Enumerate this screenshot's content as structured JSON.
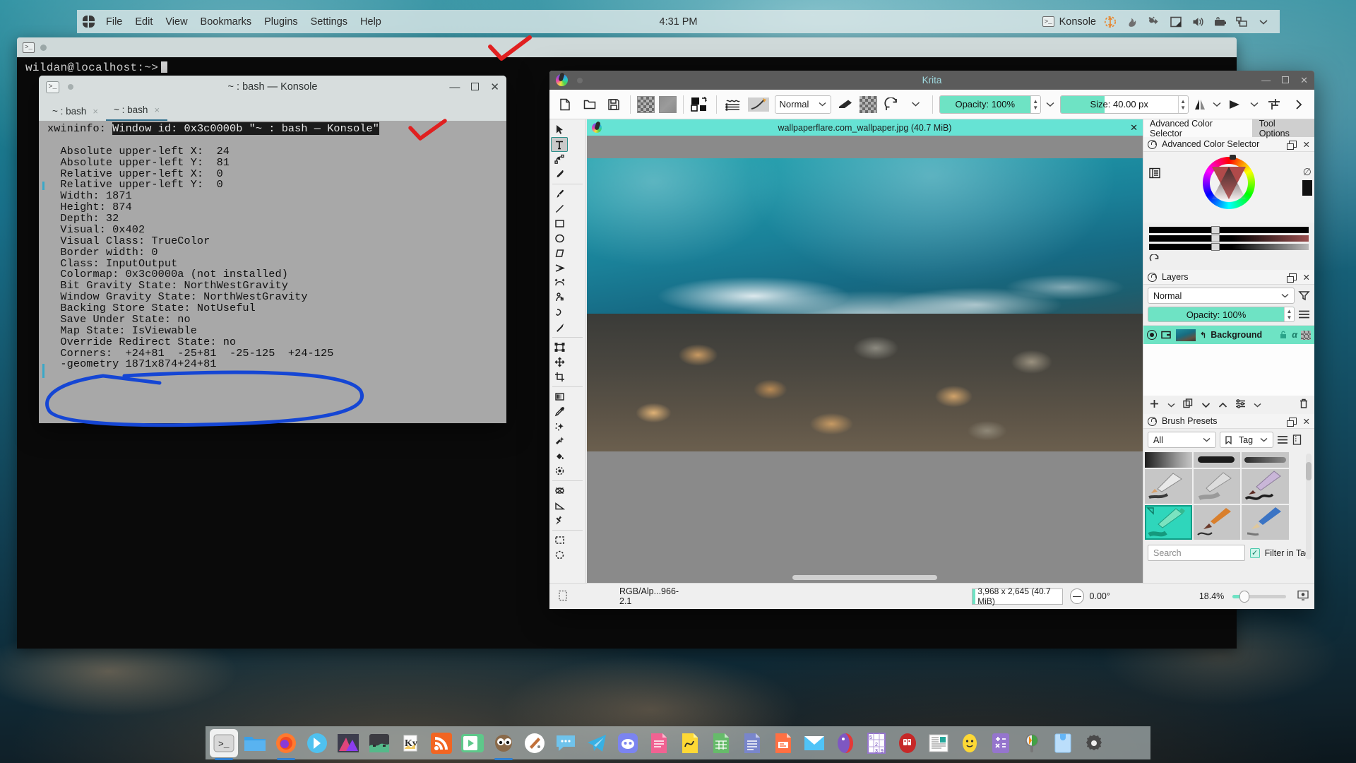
{
  "panel": {
    "menu": [
      "File",
      "Edit",
      "View",
      "Bookmarks",
      "Plugins",
      "Settings",
      "Help"
    ],
    "clock": "4:31 PM",
    "tray_label": "Konsole",
    "tray_icons": [
      "konsole-icon",
      "move-crosshair-icon",
      "flame-icon",
      "clipboard-icon",
      "display-icon",
      "volume-icon",
      "battery-icon",
      "network-icon",
      "chevron-down-icon"
    ],
    "kmenu_name": "application-launcher"
  },
  "back_window": {
    "prompt": "wildan@localhost:~>"
  },
  "konsole": {
    "title": "~ : bash — Konsole",
    "tabs": [
      {
        "label": "~ : bash",
        "close": "×",
        "active": false
      },
      {
        "label": "~ : bash",
        "close": "×",
        "active": true
      }
    ],
    "window_buttons": {
      "minimize": "—",
      "maximize": "",
      "close": "✕"
    },
    "output": {
      "cmd_label": "xwininfo:",
      "highlighted": "Window id: 0x3c0000b \"~ : bash — Konsole\"",
      "lines": [
        "",
        "  Absolute upper-left X:  24",
        "  Absolute upper-left Y:  81",
        "  Relative upper-left X:  0",
        "  Relative upper-left Y:  0",
        "  Width: 1871",
        "  Height: 874",
        "  Depth: 32",
        "  Visual: 0x402",
        "  Visual Class: TrueColor",
        "  Border width: 0",
        "  Class: InputOutput",
        "  Colormap: 0x3c0000a (not installed)",
        "  Bit Gravity State: NorthWestGravity",
        "  Window Gravity State: NorthWestGravity",
        "  Backing Store State: NotUseful",
        "  Save Under State: no",
        "  Map State: IsViewable",
        "  Override Redirect State: no",
        "  Corners:  +24+81  -25+81  -25-125  +24-125",
        "  -geometry 1871x874+24+81"
      ]
    }
  },
  "krita": {
    "window_title": "Krita",
    "window_buttons": {
      "minimize": "—",
      "maximize": "",
      "close": "✕"
    },
    "toolbar": {
      "blend_mode": "Normal",
      "opacity_label": "Opacity: 100%",
      "size_label": "Size: 40.00 px",
      "icons": [
        "new-file-icon",
        "open-file-icon",
        "save-icon",
        "pattern-swatch-icon",
        "gradient-swatch-icon",
        "fg-bg-color-icon",
        "gradient-list-icon",
        "brush-editor-icon",
        "eraser-icon",
        "preserve-alpha-icon",
        "reload-preset-icon",
        "chevron-down-icon",
        "mirror-horizontal-icon",
        "chevron-down-icon",
        "mirror-vertical-icon",
        "chevron-down-icon",
        "wrap-around-icon",
        "more-icon"
      ]
    },
    "toolbox": [
      "select-shapes-icon",
      "text-icon",
      "edit-shapes-icon",
      "calligraphy-icon",
      "freehand-brush-icon",
      "line-icon",
      "rectangle-icon",
      "ellipse-icon",
      "polygon-icon",
      "polyline-icon",
      "bezier-curve-icon",
      "freehand-path-icon",
      "dynamic-brush-icon",
      "multibrush-icon",
      "transform-icon",
      "move-icon",
      "crop-icon",
      "gradient-icon",
      "color-picker-icon",
      "colorize-mask-icon",
      "smart-patch-icon",
      "fill-icon",
      "enclose-fill-icon",
      "assistant-edit-icon",
      "measure-icon",
      "reference-images-icon",
      "rectangular-selection-icon",
      "elliptical-selection-icon"
    ],
    "document": {
      "title": "wallpaperflare.com_wallpaper.jpg (40.7 MiB)",
      "close": "✕"
    },
    "dockers": {
      "tabs": [
        {
          "label": "Advanced Color Selector",
          "active": true
        },
        {
          "label": "Tool Options",
          "active": false
        }
      ],
      "color_selector": {
        "title": "Advanced Color Selector"
      },
      "layers": {
        "title": "Layers",
        "blend_mode": "Normal",
        "opacity_label": "Opacity:  100%",
        "rows": [
          {
            "name": "Background",
            "alpha": "α",
            "selected": true
          }
        ],
        "buttons": [
          "add-layer-icon",
          "chevron-down-icon",
          "duplicate-layer-icon",
          "move-down-icon",
          "move-up-icon",
          "layer-properties-icon",
          "chevron-down-icon",
          "delete-layer-icon"
        ]
      },
      "brush_presets": {
        "title": "Brush Presets",
        "filter": "All",
        "tag": "Tag",
        "search_placeholder": "Search",
        "filter_in_tag": "Filter in Tag"
      }
    },
    "status": {
      "color_profile": "RGB/Alp...966-2.1",
      "doc_size": "3,968 x 2,645 (40.7 MiB)",
      "rotation": "0.00°",
      "zoom": "18.4%"
    }
  },
  "taskbar": {
    "items": [
      {
        "name": "konsole",
        "active": true,
        "running": true
      },
      {
        "name": "file-manager",
        "running": false
      },
      {
        "name": "firefox",
        "running": true
      },
      {
        "name": "kdenlive",
        "running": false
      },
      {
        "name": "image-viewer",
        "running": false
      },
      {
        "name": "video-editor",
        "running": false
      },
      {
        "name": "krita-vector",
        "running": false
      },
      {
        "name": "feed-reader",
        "running": false
      },
      {
        "name": "media-player",
        "running": false
      },
      {
        "name": "gimp",
        "running": true
      },
      {
        "name": "paint-app",
        "running": false
      },
      {
        "name": "messenger",
        "running": false
      },
      {
        "name": "telegram",
        "running": false
      },
      {
        "name": "discord",
        "running": false
      },
      {
        "name": "office-writer",
        "running": false
      },
      {
        "name": "office-math",
        "running": false
      },
      {
        "name": "office-calc",
        "running": false
      },
      {
        "name": "office-doc",
        "running": false
      },
      {
        "name": "office-impress",
        "running": false
      },
      {
        "name": "mail-client",
        "running": false
      },
      {
        "name": "yinyang-app",
        "running": false
      },
      {
        "name": "sudoku",
        "running": false
      },
      {
        "name": "cards-game",
        "running": false
      },
      {
        "name": "news-reader",
        "running": false
      },
      {
        "name": "emoji-app",
        "running": false
      },
      {
        "name": "calculator",
        "running": false
      },
      {
        "name": "magnifier",
        "running": false
      },
      {
        "name": "clipboard-app",
        "running": false
      },
      {
        "name": "settings",
        "running": false
      }
    ]
  },
  "annotations": {
    "checkmark_color": "#e02020",
    "circle_color": "#1546d4"
  }
}
